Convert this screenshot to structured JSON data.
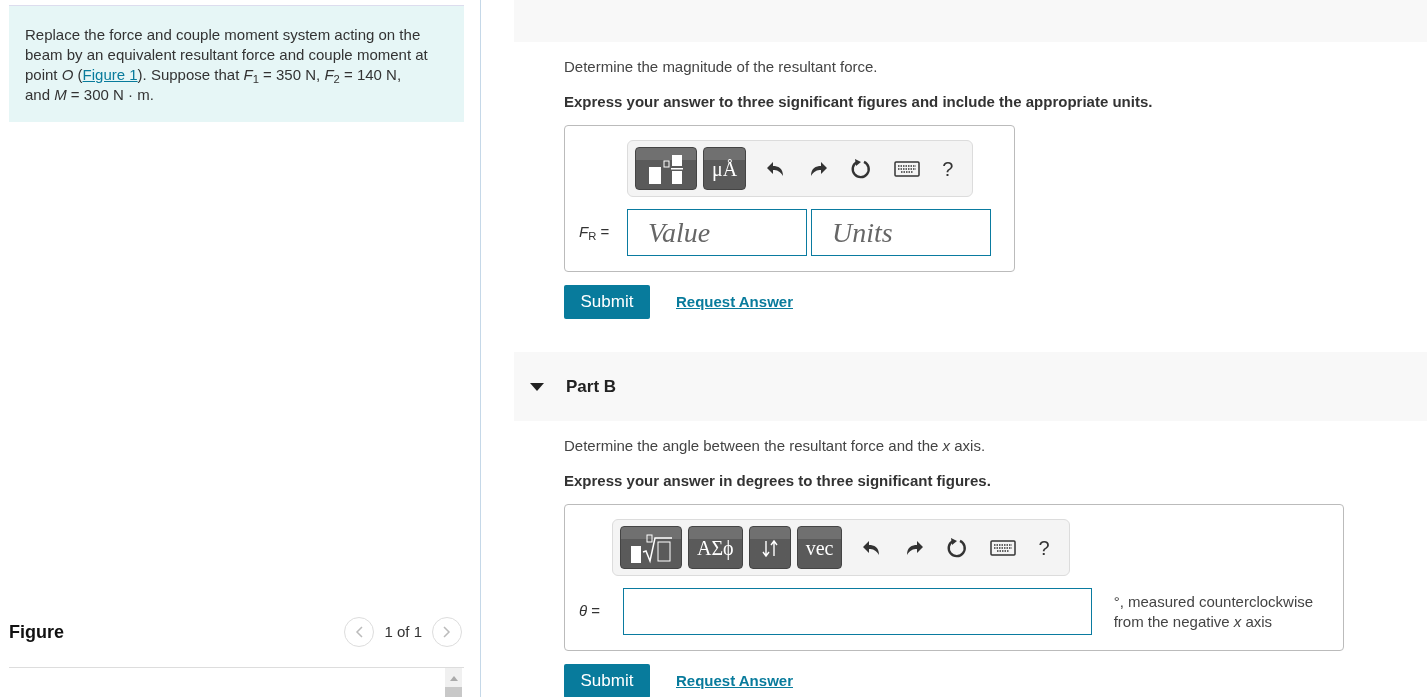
{
  "problem": {
    "text_before": "Replace the force and couple moment system acting on the beam by an equivalent resultant force and couple moment at point *O* (",
    "link": "Figure 1",
    "text_after": "). Suppose that *F*$_{1}$ = 350 N, *F*$_{2}$ = 140 N, and *M* = 300 N · m."
  },
  "figure": {
    "title": "Figure",
    "pager": "1 of 1"
  },
  "parts": [
    {
      "prompt": "Determine the magnitude of the resultant force.",
      "instruction": "Express your answer to three significant figures and include the appropriate units.",
      "tools": [
        {
          "kind": "template"
        },
        {
          "kind": "label",
          "label": "μÅ"
        }
      ],
      "help": "?",
      "answer_label": "*F*$_{R}$ =",
      "fields": [
        {
          "kind": "short",
          "placeholder": "Value"
        },
        {
          "kind": "short",
          "placeholder": "Units"
        }
      ],
      "submit": "Submit",
      "request": "Request Answer"
    },
    {
      "header": {
        "title": "Part B",
        "expanded": true
      },
      "prompt": "Determine the angle between the resultant force and the *x* axis.",
      "instruction": "Express your answer in degrees to three significant figures.",
      "tools": [
        {
          "kind": "root"
        },
        {
          "kind": "label",
          "label": "ΑΣϕ"
        },
        {
          "kind": "arrows"
        },
        {
          "kind": "label",
          "label": "vec"
        }
      ],
      "help": "?",
      "answer_label": "*θ* =",
      "fields": [
        {
          "kind": "wide"
        }
      ],
      "unit_note": "°, measured counterclockwise from the negative *x* axis",
      "submit": "Submit",
      "request": "Request Answer"
    }
  ]
}
